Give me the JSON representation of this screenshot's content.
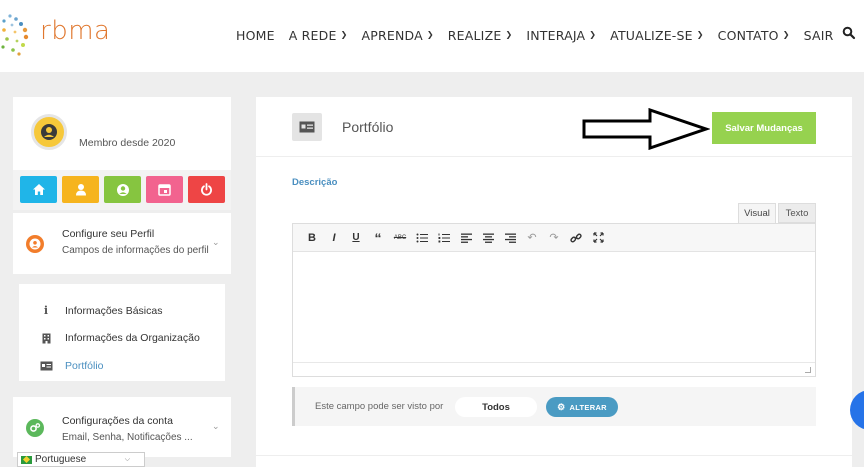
{
  "brand": {
    "name": "rbma",
    "accent": "#e0772e"
  },
  "nav": {
    "items": [
      {
        "label": "HOME",
        "has_dropdown": false
      },
      {
        "label": "A REDE",
        "has_dropdown": true
      },
      {
        "label": "APRENDA",
        "has_dropdown": true
      },
      {
        "label": "REALIZE",
        "has_dropdown": true
      },
      {
        "label": "INTERAJA",
        "has_dropdown": true
      },
      {
        "label": "ATUALIZE-SE",
        "has_dropdown": true
      },
      {
        "label": "CONTATO",
        "has_dropdown": true
      },
      {
        "label": "SAIR",
        "has_dropdown": false
      }
    ],
    "search_icon": "search-icon"
  },
  "sidebar": {
    "member_since": "Membro desde 2020",
    "quick_buttons": [
      {
        "icon": "home-icon",
        "color": "#20b5e8"
      },
      {
        "icon": "user-icon",
        "color": "#f6b41e"
      },
      {
        "icon": "user-circle-icon",
        "color": "#86c540"
      },
      {
        "icon": "calendar-icon",
        "color": "#f2638f"
      },
      {
        "icon": "power-icon",
        "color": "#ee4545"
      }
    ],
    "profile_section": {
      "title": "Configure seu Perfil",
      "subtitle": "Campos de informações do perfil",
      "icon_color": "#f27d2b"
    },
    "menu": [
      {
        "label": "Informações Básicas",
        "icon": "info-icon",
        "active": false
      },
      {
        "label": "Informações da Organização",
        "icon": "building-icon",
        "active": false
      },
      {
        "label": "Portfólio",
        "icon": "id-card-icon",
        "active": true
      }
    ],
    "account_section": {
      "title": "Configurações da conta",
      "subtitle": "Email, Senha, Notificações ...",
      "icon_color": "#5cb85c"
    },
    "language": "Portuguese"
  },
  "main": {
    "title": "Portfólio",
    "save_label": "Salvar Mudanças",
    "save_color": "#96d24f",
    "field_label": "Descrição",
    "tabs": [
      "Visual",
      "Texto"
    ],
    "toolbar": [
      "bold-icon",
      "italic-icon",
      "underline-icon",
      "blockquote-icon",
      "strikethrough-icon",
      "bullet-list-icon",
      "numbered-list-icon",
      "align-left-icon",
      "align-center-icon",
      "align-right-icon",
      "undo-icon",
      "redo-icon",
      "link-icon",
      "fullscreen-icon"
    ],
    "editor_value": "",
    "visibility_label": "Este campo pode ser visto por",
    "visibility_value": "Todos",
    "change_label": "ALTERAR"
  }
}
